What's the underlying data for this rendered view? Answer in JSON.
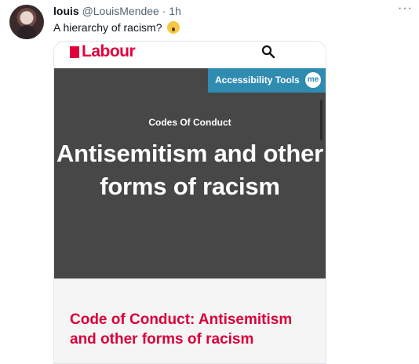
{
  "tweet": {
    "name": "louis",
    "handle": "@LouisMendee",
    "separator": "·",
    "time": "1h",
    "text": "A hierarchy of racism?",
    "more_label": "···"
  },
  "screenshot": {
    "logo_text": "Labour",
    "accessibility_label": "Accessibility Tools",
    "me_badge": "me",
    "eyebrow": "Codes Of Conduct",
    "headline": "Antisemitism and other forms of racism",
    "section_title": "Code of Conduct: Antisemitism and other forms of racism",
    "brand_color": "#e4003b"
  }
}
